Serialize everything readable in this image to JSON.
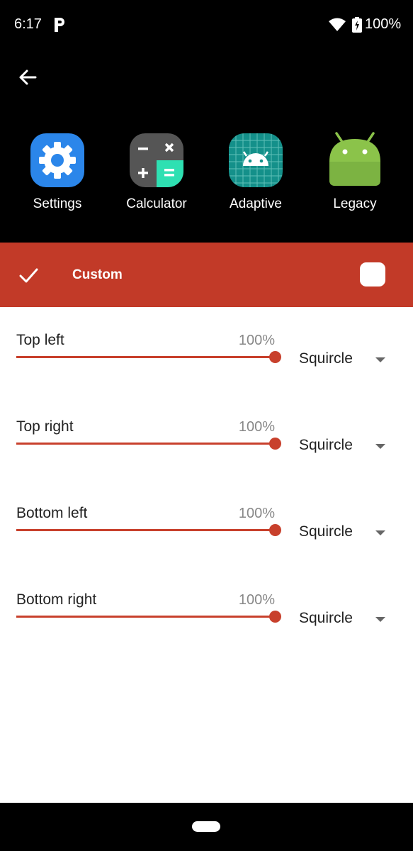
{
  "status_bar": {
    "time": "6:17",
    "battery": "100%"
  },
  "apps": [
    {
      "label": "Settings",
      "icon": "settings-gear-icon"
    },
    {
      "label": "Calculator",
      "icon": "calculator-icon"
    },
    {
      "label": "Adaptive",
      "icon": "adaptive-android-icon"
    },
    {
      "label": "Legacy",
      "icon": "legacy-android-icon"
    }
  ],
  "header": {
    "title": "Custom"
  },
  "corners": [
    {
      "label": "Top left",
      "value_text": "100%",
      "value": 1.0,
      "shape": "Squircle"
    },
    {
      "label": "Top right",
      "value_text": "100%",
      "value": 1.0,
      "shape": "Squircle"
    },
    {
      "label": "Bottom left",
      "value_text": "100%",
      "value": 1.0,
      "shape": "Squircle"
    },
    {
      "label": "Bottom right",
      "value_text": "100%",
      "value": 1.0,
      "shape": "Squircle"
    }
  ],
  "colors": {
    "accent": "#c23a28",
    "slider": "#c8402c",
    "background_top": "#000000"
  }
}
